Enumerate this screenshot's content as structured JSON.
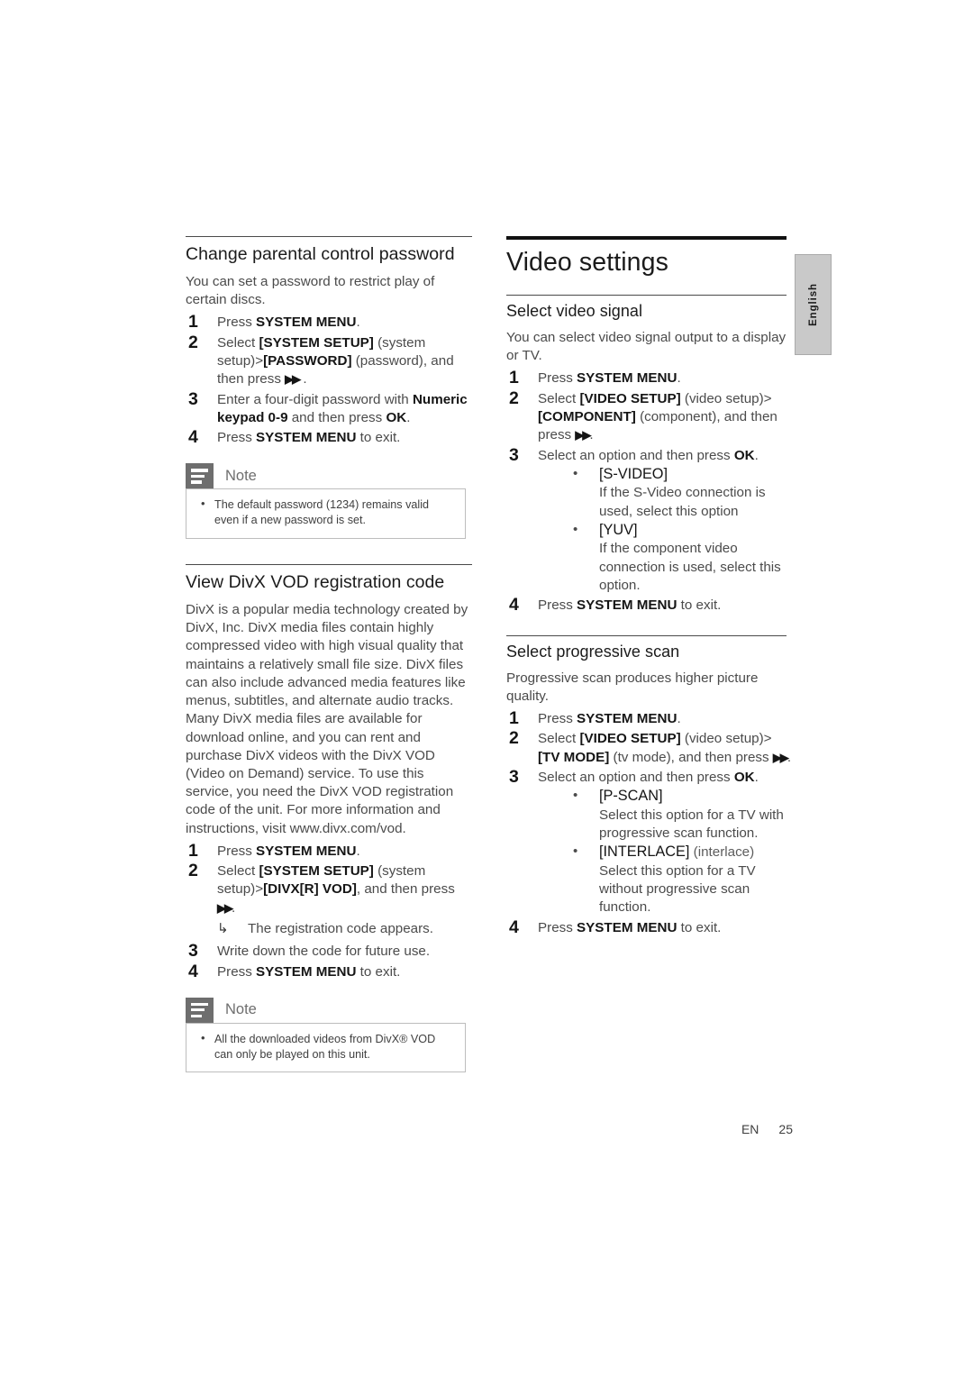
{
  "page": {
    "language_tab": "English",
    "footer_lang_code": "EN",
    "footer_page_number": "25"
  },
  "left_column": {
    "section_1": {
      "heading": "Change parental control password",
      "intro": "You can set a password to restrict play of certain discs.",
      "steps": [
        {
          "prefix": "Press ",
          "bold1": "SYSTEM MENU",
          "suffix": "."
        },
        {
          "prefix": "Select ",
          "bold1": "[SYSTEM SETUP]",
          "mid1": " (system setup)>",
          "bold2": "[PASSWORD]",
          "mid2": " (password), and then press ",
          "suffix": " ."
        },
        {
          "prefix": "Enter a four-digit password with ",
          "bold1": "Numeric keypad 0-9",
          "mid1": " and then press ",
          "bold2": "OK",
          "suffix": "."
        },
        {
          "prefix": "Press ",
          "bold1": "SYSTEM MENU",
          "suffix": " to exit."
        }
      ],
      "note": {
        "title": "Note",
        "items": [
          "The default password (1234) remains valid even if a new password is set."
        ]
      }
    },
    "section_2": {
      "heading": "View DivX VOD registration code",
      "intro": "DivX is a popular media technology created by DivX, Inc. DivX media files contain highly compressed video with high visual quality that maintains a relatively small file size. DivX files can also include advanced media features like menus, subtitles, and alternate audio tracks. Many DivX media files are available for download online, and you can rent and purchase DivX videos with the DivX VOD (Video on Demand) service. To use this service, you need the DivX VOD registration code of the unit. For more information and instructions, visit www.divx.com/vod.",
      "steps": [
        {
          "prefix": "Press ",
          "bold1": "SYSTEM MENU",
          "suffix": "."
        },
        {
          "prefix": "Select ",
          "bold1": "[SYSTEM SETUP]",
          "mid1": " (system setup)>",
          "bold2": "[DIVX[R] VOD]",
          "mid2": ", and then press ",
          "suffix": "."
        },
        {
          "prefix": "Write down the code for future use.",
          "bold1": "",
          "suffix": ""
        },
        {
          "prefix": "Press ",
          "bold1": "SYSTEM MENU",
          "suffix": " to exit."
        }
      ],
      "result_text": "The registration code appears.",
      "note": {
        "title": "Note",
        "items": [
          "All the downloaded videos from DivX® VOD can only be played on this unit."
        ]
      }
    }
  },
  "right_column": {
    "chapter_title": "Video settings",
    "section_1": {
      "heading": "Select video signal",
      "intro": "You can select video signal output to a display or TV.",
      "steps": [
        {
          "prefix": "Press ",
          "bold1": "SYSTEM MENU",
          "suffix": "."
        },
        {
          "prefix": "Select ",
          "bold1": "[VIDEO SETUP]",
          "mid1": " (video setup)>",
          "bold2": "[COMPONENT]",
          "mid2": " (component), and then press ",
          "suffix": "."
        },
        {
          "prefix": "Select an option and then press ",
          "bold1": "OK",
          "suffix": "."
        },
        {
          "prefix": "Press ",
          "bold1": "SYSTEM MENU",
          "suffix": " to exit."
        }
      ],
      "options": [
        {
          "name": "[S-VIDEO]",
          "paren": "",
          "desc": "If the S-Video connection is used, select this option"
        },
        {
          "name": "[YUV]",
          "paren": "",
          "desc": "If the component video connection is used, select this option."
        }
      ]
    },
    "section_2": {
      "heading": "Select progressive scan",
      "intro": "Progressive scan produces higher picture quality.",
      "steps": [
        {
          "prefix": "Press ",
          "bold1": "SYSTEM MENU",
          "suffix": "."
        },
        {
          "prefix": "Select ",
          "bold1": "[VIDEO SETUP]",
          "mid1": " (video setup)>",
          "bold2": "[TV MODE]",
          "mid2": " (tv mode), and then press ",
          "suffix": "."
        },
        {
          "prefix": "Select an option and then press ",
          "bold1": "OK",
          "suffix": "."
        },
        {
          "prefix": "Press ",
          "bold1": "SYSTEM MENU",
          "suffix": " to exit."
        }
      ],
      "options": [
        {
          "name": "[P-SCAN]",
          "paren": "",
          "desc": "Select this option for a TV with progressive scan function."
        },
        {
          "name": "[INTERLACE]",
          "paren": " (interlace)",
          "desc": "Select this option for a TV without progressive scan function."
        }
      ]
    }
  },
  "icons": {
    "note_icon": "note-lines-icon",
    "fast_forward": "▶▶",
    "result_arrow": "↳",
    "bullet": "•"
  }
}
